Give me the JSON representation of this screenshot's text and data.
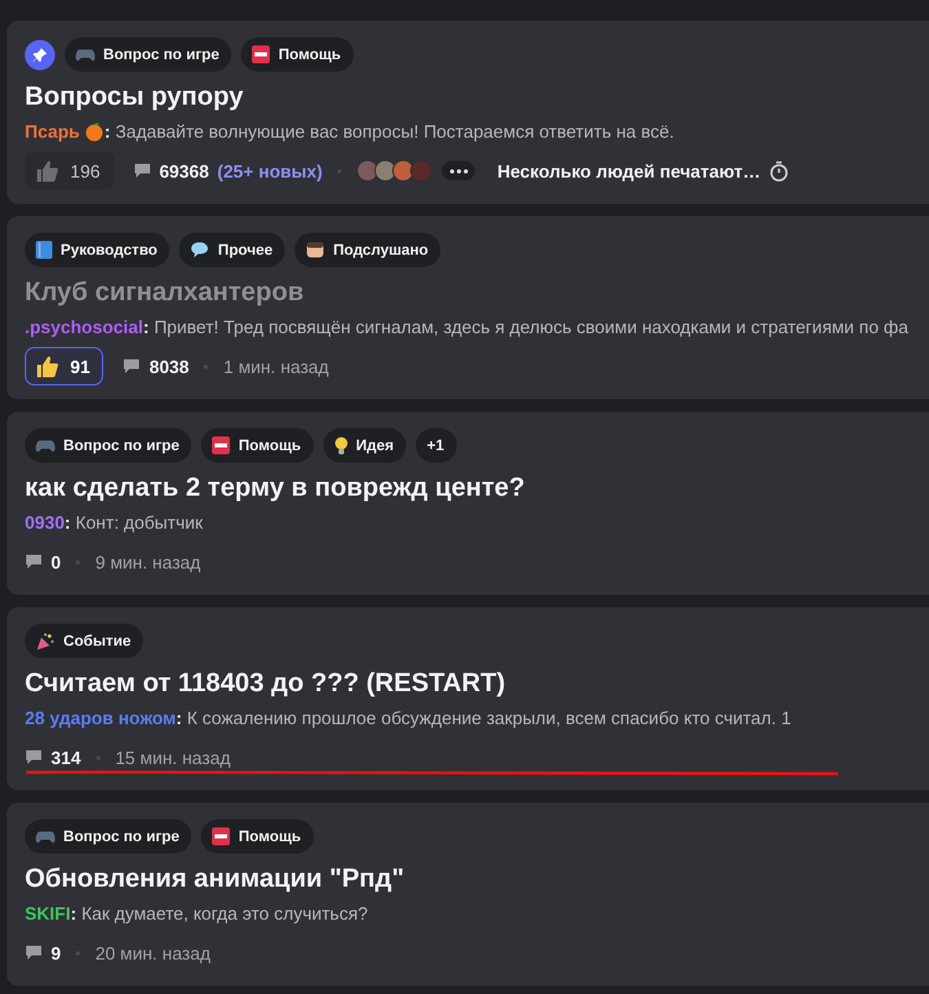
{
  "posts": [
    {
      "pinned": true,
      "read": false,
      "highlighted": false,
      "tags": [
        {
          "kind": "game",
          "label": "Вопрос по игре"
        },
        {
          "kind": "sos",
          "label": "Помощь"
        }
      ],
      "title": "Вопросы рупору",
      "author": {
        "name": "Псарь",
        "color": "#f0703a",
        "badge": true
      },
      "message": "**:** Задавайте волнующие вас вопросы! Постараемся ответить на всё.",
      "reactions": {
        "count": "196",
        "selected": false
      },
      "comments": "69368",
      "new_comments": "(25+ новых)",
      "typing": {
        "avatars": [
          {
            "color": "#7a5a5a"
          },
          {
            "color": "#8a8070"
          },
          {
            "color": "#c0603a"
          },
          {
            "color": "#5a2a2a"
          }
        ],
        "text": "Несколько людей печатают…"
      }
    },
    {
      "pinned": false,
      "read": true,
      "highlighted": false,
      "tags": [
        {
          "kind": "guide",
          "label": "Руководство"
        },
        {
          "kind": "chat",
          "label": "Прочее"
        },
        {
          "kind": "face",
          "label": "Подслушано"
        }
      ],
      "title": "Клуб сигналхантеров",
      "author": {
        "name": ".psychosocial",
        "color": "#b05cf5",
        "badge": false
      },
      "message": "**:** Привет! Тред посвящён сигналам, здесь я делюсь своими находками и стратегиями по фа",
      "reactions": {
        "count": "91",
        "selected": true
      },
      "comments": "8038",
      "time": "1 мин. назад"
    },
    {
      "pinned": false,
      "read": false,
      "highlighted": false,
      "tags": [
        {
          "kind": "game",
          "label": "Вопрос по игре"
        },
        {
          "kind": "sos",
          "label": "Помощь"
        },
        {
          "kind": "idea",
          "label": "Идея"
        },
        {
          "kind": "more",
          "label": "+1"
        }
      ],
      "title": "как сделать 2 терму в поврежд центе?",
      "author": {
        "name": "0930",
        "color": "#a070f5",
        "badge": false
      },
      "message": "**:** Конт: добытчик",
      "comments": "0",
      "time": "9 мин. назад"
    },
    {
      "pinned": false,
      "read": false,
      "highlighted": true,
      "tags": [
        {
          "kind": "event",
          "label": "Событие"
        }
      ],
      "title": "Считаем от 118403 до ??? (RESTART)",
      "author": {
        "name": "28 ударов ножом",
        "color": "#5a7cf5",
        "badge": false
      },
      "message": "**:** К сожалению прошлое обсуждение закрыли, всем спасибо кто считал. 1",
      "comments": "314",
      "time": "15 мин. назад"
    },
    {
      "pinned": false,
      "read": false,
      "highlighted": false,
      "tags": [
        {
          "kind": "game",
          "label": "Вопрос по игре"
        },
        {
          "kind": "sos",
          "label": "Помощь"
        }
      ],
      "title": "Обновления анимации \"Рпд\"",
      "author": {
        "name": "SKIFI",
        "color": "#3ec45a",
        "badge": false
      },
      "message": "**:** Как думаете, когда это случиться?",
      "comments": "9",
      "time": "20 мин. назад"
    }
  ]
}
